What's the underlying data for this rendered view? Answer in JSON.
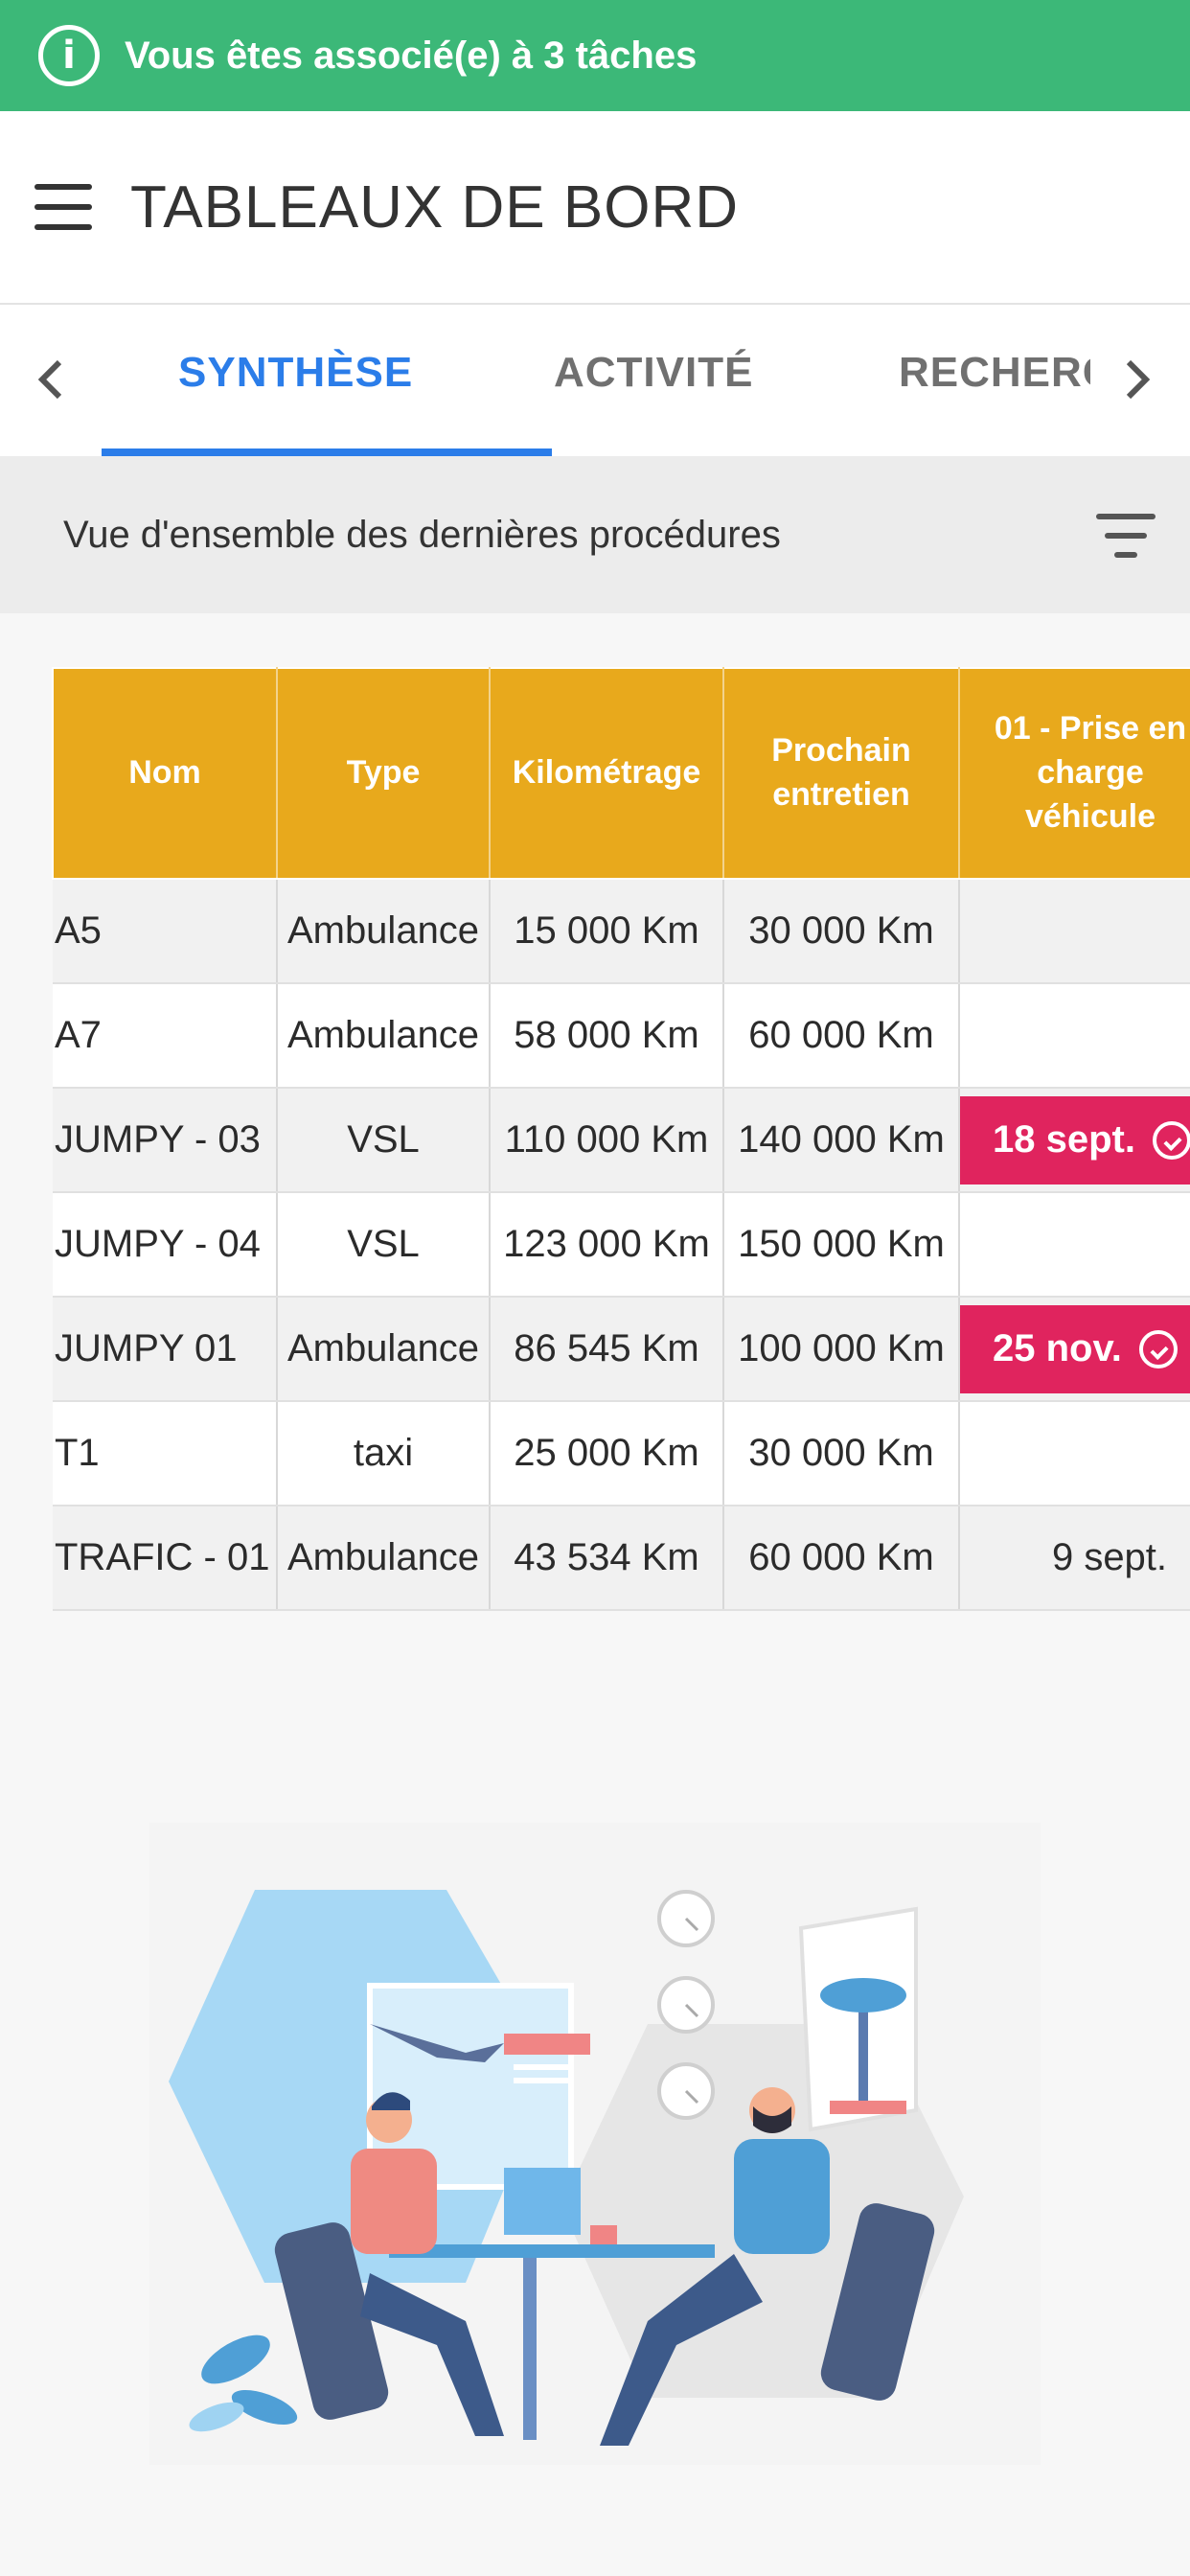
{
  "banner": {
    "text": "Vous êtes associé(e) à 3 tâches",
    "icon": "info-icon"
  },
  "header": {
    "title": "TABLEAUX DE BORD",
    "menu_icon": "menu-icon"
  },
  "tabs": [
    {
      "label": "SYNTHÈSE",
      "active": true
    },
    {
      "label": "ACTIVITÉ",
      "active": false
    },
    {
      "label": "RECHERCHE",
      "active": false
    }
  ],
  "subheader": {
    "text": "Vue d'ensemble des dernières procédures",
    "filter_icon": "filter-icon"
  },
  "table": {
    "columns": [
      "Nom",
      "Type",
      "Kilométrage",
      "Prochain entretien",
      "01 - Prise en charge véhicule"
    ],
    "rows": [
      {
        "nom": "A5",
        "type": "Ambulance",
        "km": "15 000 Km",
        "next": "30 000 Km",
        "prise": ""
      },
      {
        "nom": "A7",
        "type": "Ambulance",
        "km": "58 000 Km",
        "next": "60 000 Km",
        "prise": ""
      },
      {
        "nom": "JUMPY - 03",
        "type": "VSL",
        "km": "110 000 Km",
        "next": "140 000 Km",
        "prise": "18 sept.",
        "prise_alert": true
      },
      {
        "nom": "JUMPY - 04",
        "type": "VSL",
        "km": "123 000 Km",
        "next": "150 000 Km",
        "prise": ""
      },
      {
        "nom": "JUMPY 01",
        "type": "Ambulance",
        "km": "86 545 Km",
        "next": "100 000 Km",
        "prise": "25 nov.",
        "prise_alert": true
      },
      {
        "nom": "T1",
        "type": "taxi",
        "km": "25 000 Km",
        "next": "30 000 Km",
        "prise": ""
      },
      {
        "nom": "TRAFIC - 01",
        "type": "Ambulance",
        "km": "43 534 Km",
        "next": "60 000 Km",
        "prise": "9 sept."
      }
    ]
  },
  "colors": {
    "banner": "#3cb878",
    "accent": "#2b7de9",
    "table_header": "#e8a91c",
    "alert": "#e0245e"
  }
}
